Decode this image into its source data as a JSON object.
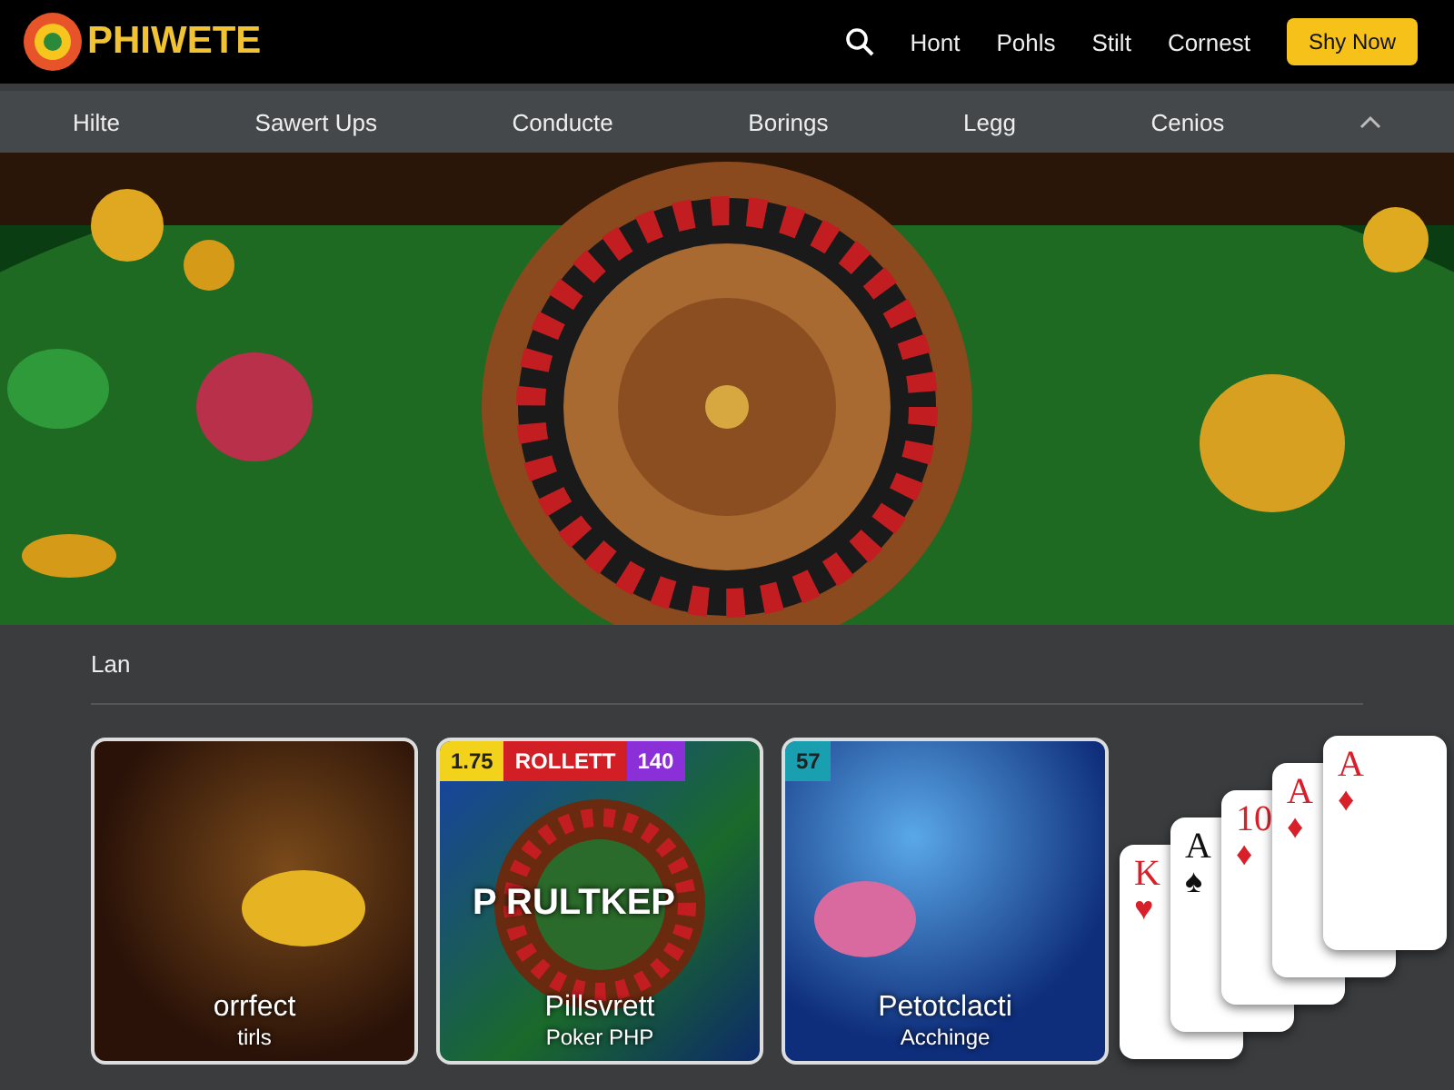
{
  "header": {
    "logo_text": "PHIWETE",
    "links": [
      "Hont",
      "Pohls",
      "Stilt",
      "Cornest"
    ],
    "cta": "Shy Now"
  },
  "nav": {
    "items": [
      "Hilte",
      "Sawert Ups",
      "Conducte",
      "Borings",
      "Legg",
      "Cenios"
    ]
  },
  "section": {
    "label": "Lan"
  },
  "tiles": [
    {
      "kind": "casino",
      "title": "orrfect",
      "subtitle": "tirls"
    },
    {
      "kind": "roulette",
      "badges": [
        {
          "text": "1.75",
          "color": "#f2d21b"
        },
        {
          "text": "ROLLETT",
          "color": "#d21f26"
        },
        {
          "text": "140",
          "color": "#8b2fd8"
        }
      ],
      "overlay": "P RULTKEP",
      "title": "Pillsvrett",
      "subtitle": "Poker PHP"
    },
    {
      "kind": "slots",
      "badges": [
        {
          "text": "57",
          "color": "#1a9fb0"
        }
      ],
      "title": "Petotclacti",
      "subtitle": "Acchinge"
    }
  ],
  "cards": [
    {
      "rank": "K",
      "suit": "♥",
      "color": "#d8202a"
    },
    {
      "rank": "A",
      "suit": "♠",
      "color": "#111111"
    },
    {
      "rank": "10",
      "suit": "♦",
      "color": "#d8202a"
    },
    {
      "rank": "A",
      "suit": "♦",
      "color": "#d8202a"
    },
    {
      "rank": "A",
      "suit": "♦",
      "color": "#d8202a"
    }
  ]
}
